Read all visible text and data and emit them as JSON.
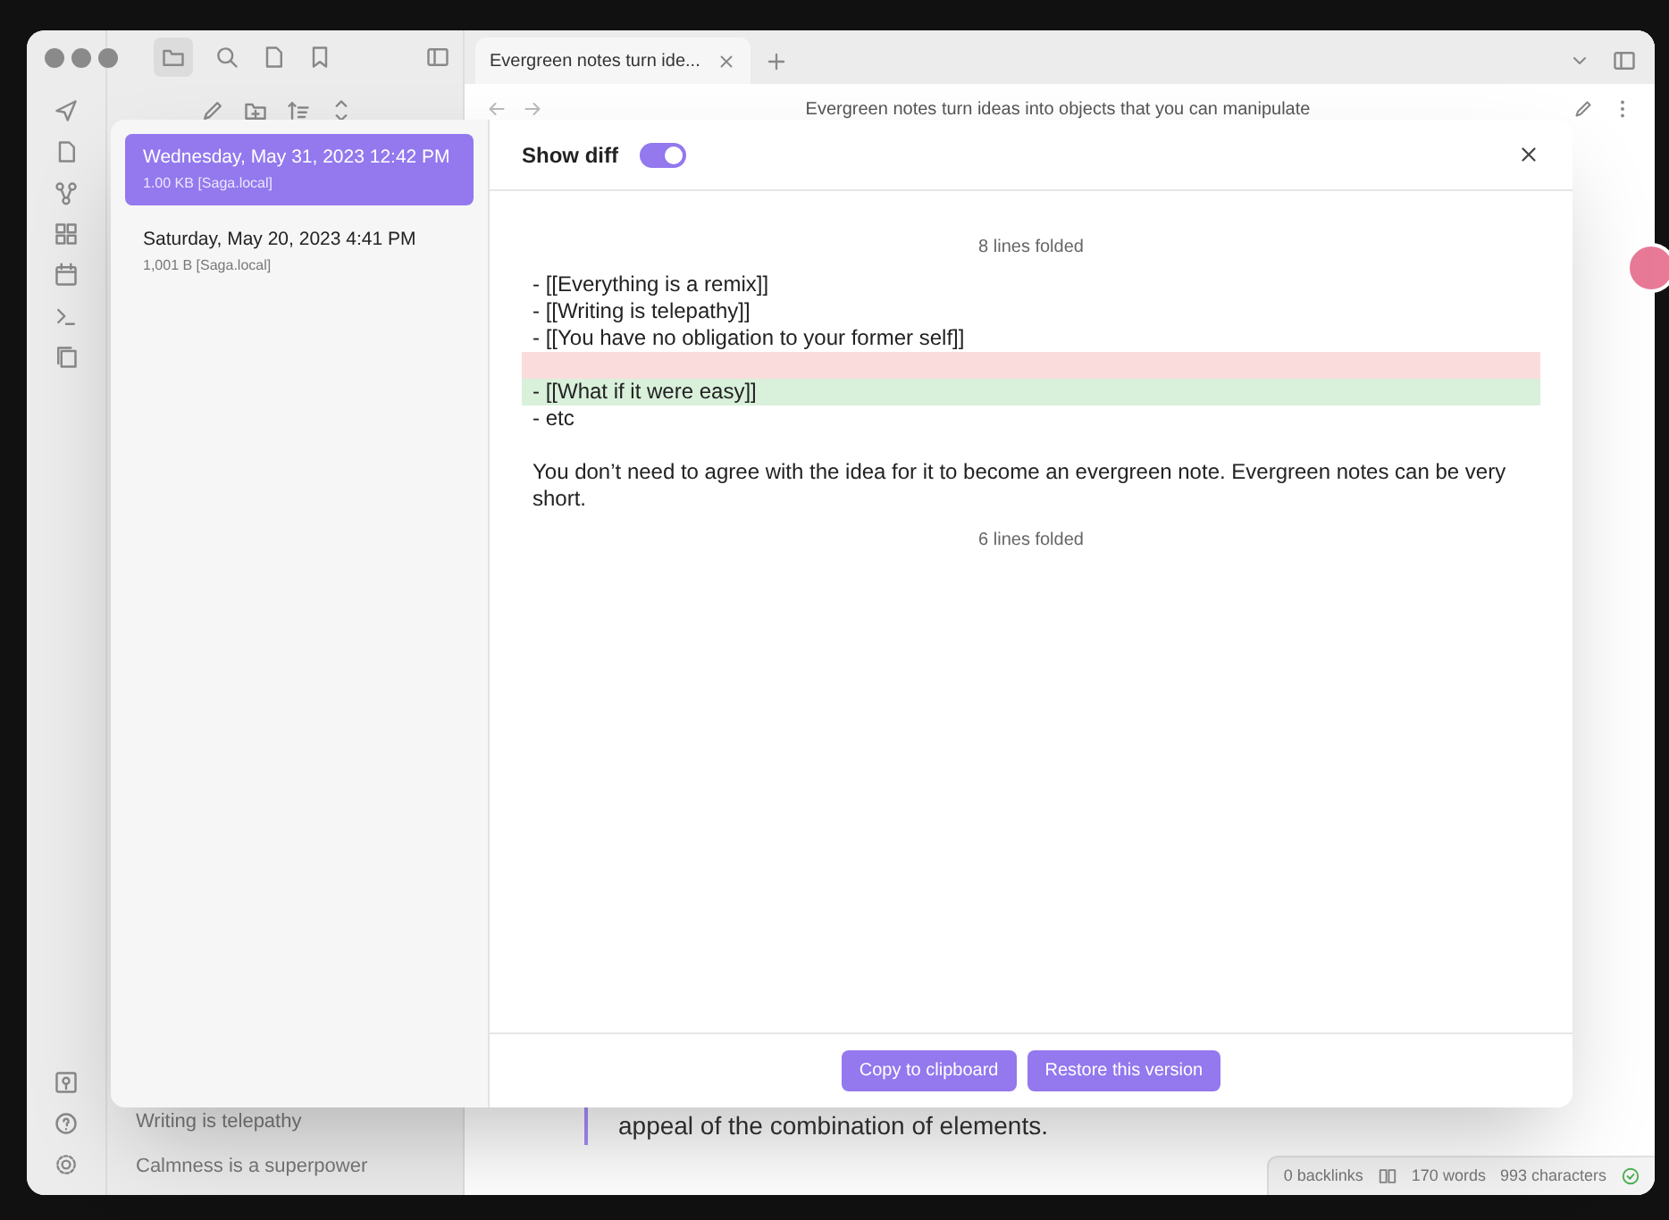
{
  "tab": {
    "title": "Evergreen notes turn ide..."
  },
  "note_title": "Evergreen notes turn ideas into objects that you can manipulate",
  "sidebar": {
    "files": [
      "Writing is telepathy",
      "Calmness is a superpower"
    ]
  },
  "editor": {
    "text": "appeal of the combination of elements."
  },
  "status_bar": {
    "backlinks": "0 backlinks",
    "words": "170 words",
    "characters": "993 characters"
  },
  "dialog": {
    "versions": [
      {
        "date": "Wednesday, May 31, 2023 12:42 PM",
        "size": "1.00 KB [Saga.local]",
        "selected": true
      },
      {
        "date": "Saturday, May 20, 2023 4:41 PM",
        "size": "1,001 B [Saga.local]",
        "selected": false
      }
    ],
    "show_diff": {
      "label": "Show diff",
      "on": true
    },
    "diff": [
      {
        "kind": "fold",
        "text": "8 lines folded"
      },
      {
        "kind": "line",
        "text": "- [[Everything is a remix]]"
      },
      {
        "kind": "line",
        "text": "- [[Writing is telepathy]]"
      },
      {
        "kind": "line",
        "text": "- [[You have no obligation to your former self]]"
      },
      {
        "kind": "removed"
      },
      {
        "kind": "added",
        "text": "- [[What if it were easy]]"
      },
      {
        "kind": "line",
        "text": "- etc"
      },
      {
        "kind": "blank"
      },
      {
        "kind": "line",
        "text": "You don’t need to agree with the idea for it to become an evergreen note. Evergreen notes can be very short."
      },
      {
        "kind": "fold",
        "text": "6 lines folded"
      }
    ],
    "buttons": [
      "Copy to clipboard",
      "Restore this version"
    ]
  }
}
